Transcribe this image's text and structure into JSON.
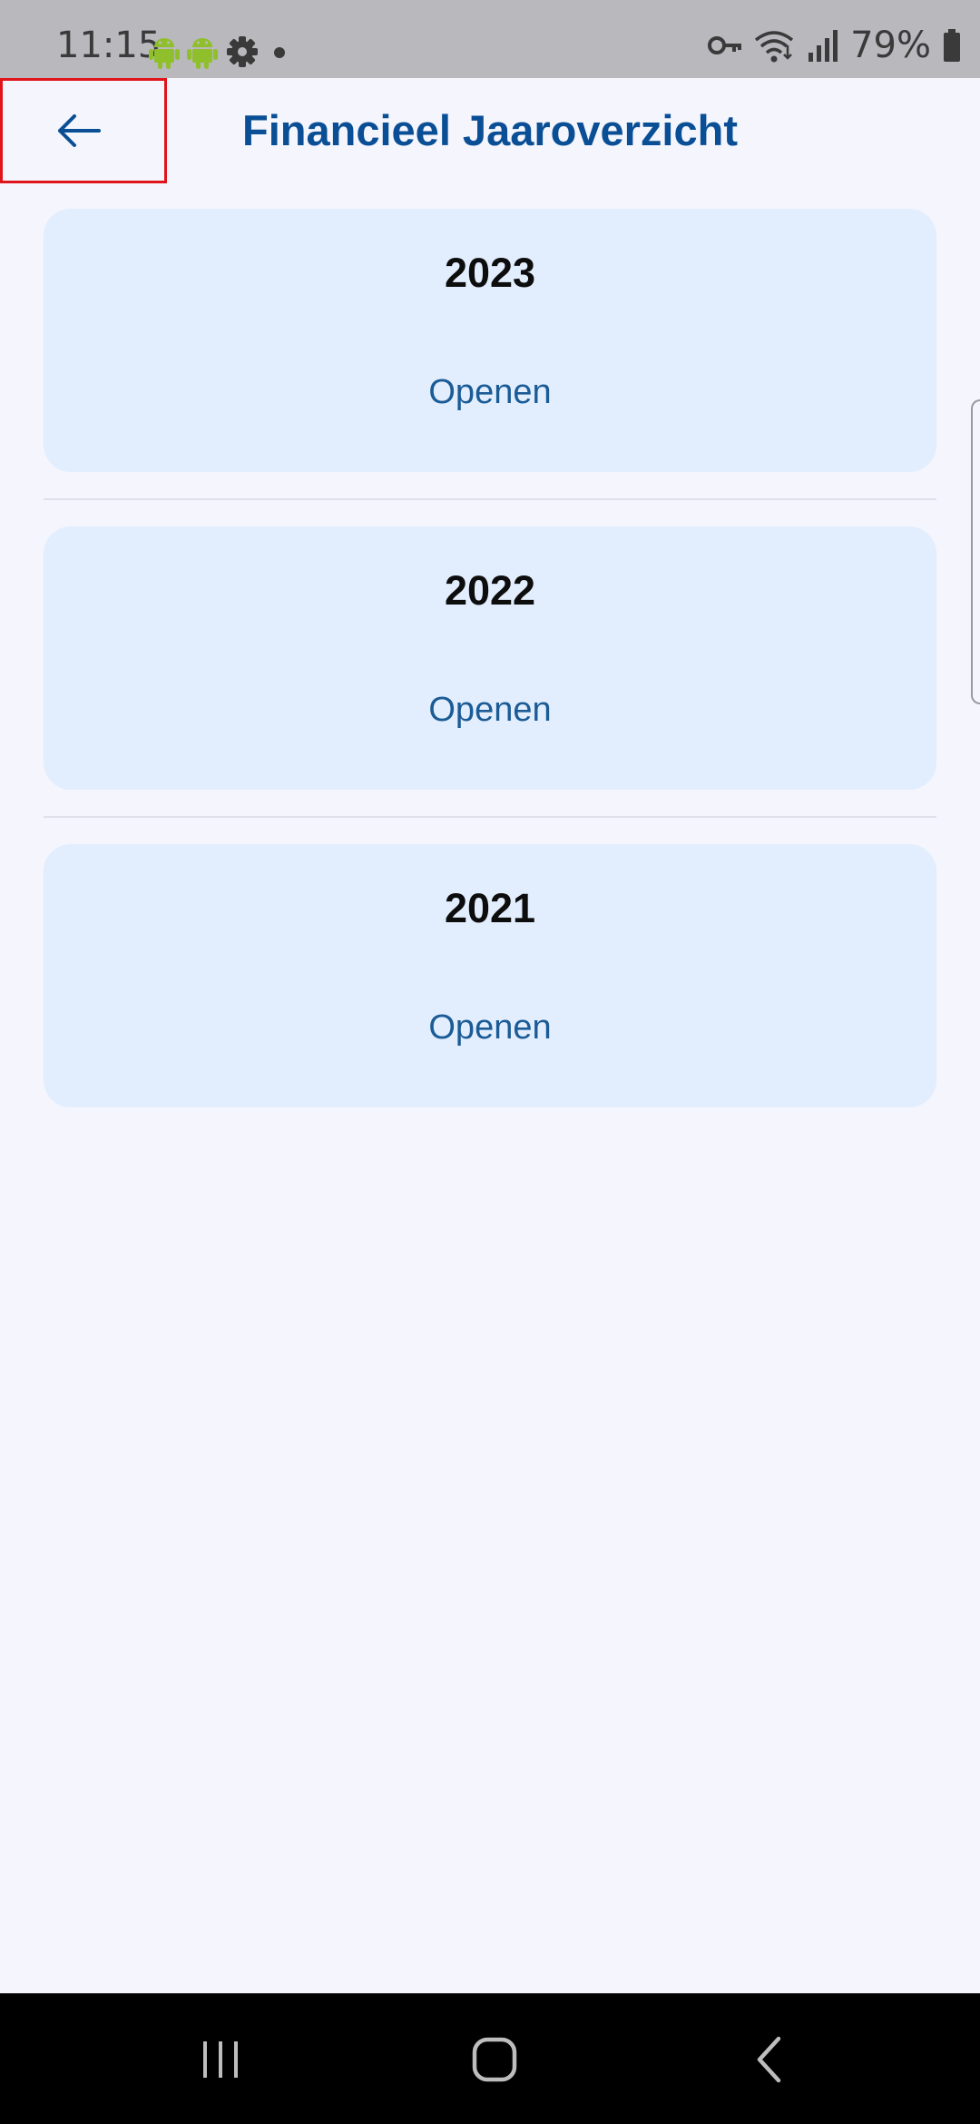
{
  "status_bar": {
    "time": "11:15",
    "battery": "79%",
    "left_icons": [
      "android-icon",
      "android-icon",
      "settings-gear-icon",
      "dot-icon"
    ],
    "right_icons": [
      "vpn-key-icon",
      "wifi-icon",
      "signal-icon",
      "battery-icon"
    ]
  },
  "header": {
    "title": "Financieel Jaaroverzicht",
    "back_icon": "arrow-left-icon"
  },
  "years": [
    {
      "year": "2023",
      "action": "Openen"
    },
    {
      "year": "2022",
      "action": "Openen"
    },
    {
      "year": "2021",
      "action": "Openen"
    }
  ],
  "nav_bar": {
    "icons": [
      "recent-apps-icon",
      "home-icon",
      "back-icon"
    ]
  },
  "colors": {
    "accent": "#0a4f95",
    "link": "#1b5b96",
    "card_background": "#e2eefd",
    "page_background": "#f4f5fd",
    "highlight_border": "#e0141a"
  }
}
